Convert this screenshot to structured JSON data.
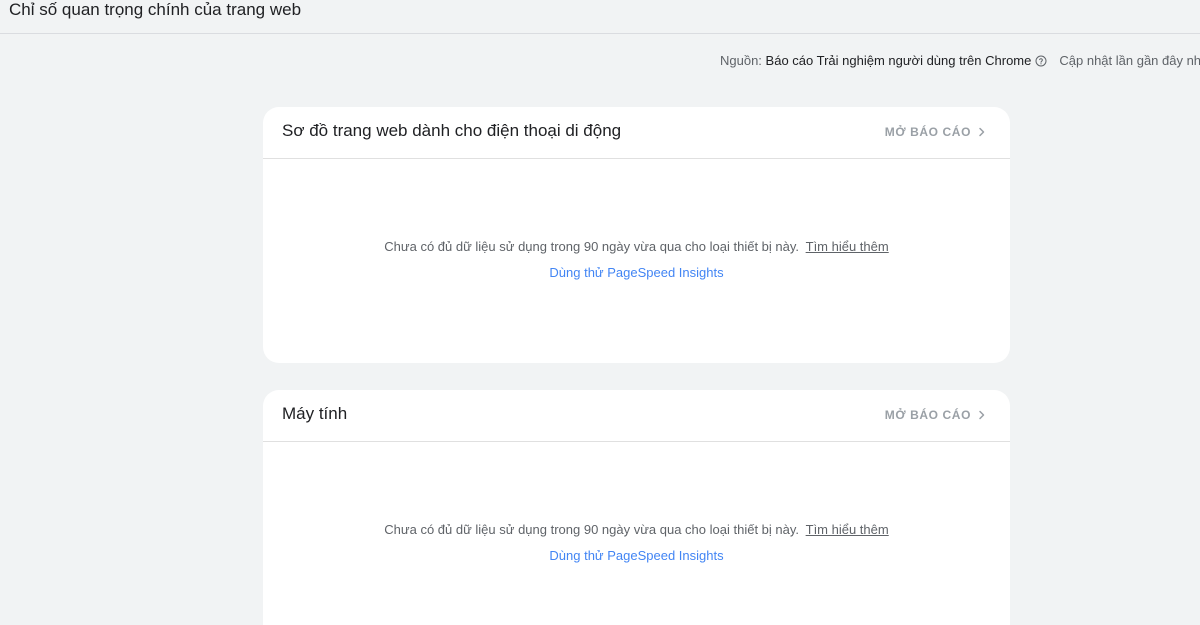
{
  "page_title": "Chỉ số quan trọng chính của trang web",
  "source": {
    "label": "Nguồn: ",
    "report_name": "Báo cáo Trải nghiệm người dùng trên Chrome",
    "help_icon": "help-circle-icon",
    "updated_text": "Cập nhật lần gần đây nh"
  },
  "cards": {
    "mobile": {
      "title": "Sơ đồ trang web dành cho điện thoại di động",
      "open_report_label": "MỞ BÁO CÁO",
      "message": "Chưa có đủ dữ liệu sử dụng trong 90 ngày vừa qua cho loại thiết bị này.",
      "learn_more_label": "Tìm hiểu thêm",
      "pagespeed_label": "Dùng thử PageSpeed Insights"
    },
    "desktop": {
      "title": "Máy tính",
      "open_report_label": "MỞ BÁO CÁO",
      "message": "Chưa có đủ dữ liệu sử dụng trong 90 ngày vừa qua cho loại thiết bị này.",
      "learn_more_label": "Tìm hiểu thêm",
      "pagespeed_label": "Dùng thử PageSpeed Insights"
    }
  },
  "colors": {
    "background": "#f1f3f4",
    "card": "#ffffff",
    "link_blue": "#4285f4",
    "muted_text": "#5f6368",
    "disabled_text": "#9aa0a6"
  }
}
